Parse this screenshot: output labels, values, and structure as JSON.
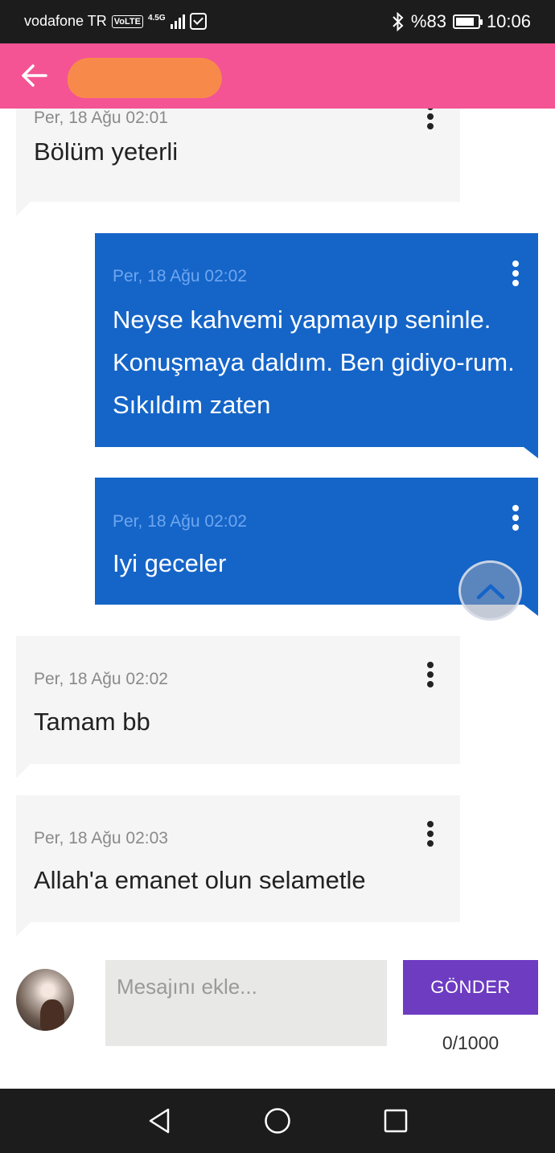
{
  "status_bar": {
    "carrier": "vodafone TR",
    "volte": "VoLTE",
    "network": "4.5G",
    "battery_percent": "%83",
    "battery_level": 0.83,
    "time": "10:06"
  },
  "app_bar": {
    "back_icon": "arrow-left-icon",
    "title_redacted": true,
    "colors": {
      "background": "#f45494"
    }
  },
  "messages": [
    {
      "direction": "incoming",
      "timestamp": "Per, 18 Ağu 02:01",
      "text": "Bölüm yeterli"
    },
    {
      "direction": "outgoing",
      "timestamp": "Per, 18 Ağu 02:02",
      "text": "Neyse kahvemi yapmayıp seninle. Konuşmaya daldım. Ben gidiyo-rum. Sıkıldım zaten"
    },
    {
      "direction": "outgoing",
      "timestamp": "Per, 18 Ağu 02:02",
      "text": "Iyi geceler"
    },
    {
      "direction": "incoming",
      "timestamp": "Per, 18 Ağu 02:02",
      "text": "Tamam bb"
    },
    {
      "direction": "incoming",
      "timestamp": "Per, 18 Ağu 02:03",
      "text": "Allah'a emanet olun selametle"
    }
  ],
  "composer": {
    "placeholder": "Mesajını ekle...",
    "value": "",
    "send_label": "GÖNDER",
    "char_count": "0/1000"
  },
  "colors": {
    "incoming_bubble": "#f5f5f5",
    "outgoing_bubble": "#1565c8",
    "send_button": "#6d3cc1",
    "status_bar": "#1c1c1c"
  },
  "icons": [
    "bluetooth-icon",
    "battery-icon",
    "more-vert-icon",
    "chevron-up-icon",
    "back-triangle-icon",
    "home-circle-icon",
    "recents-square-icon"
  ]
}
